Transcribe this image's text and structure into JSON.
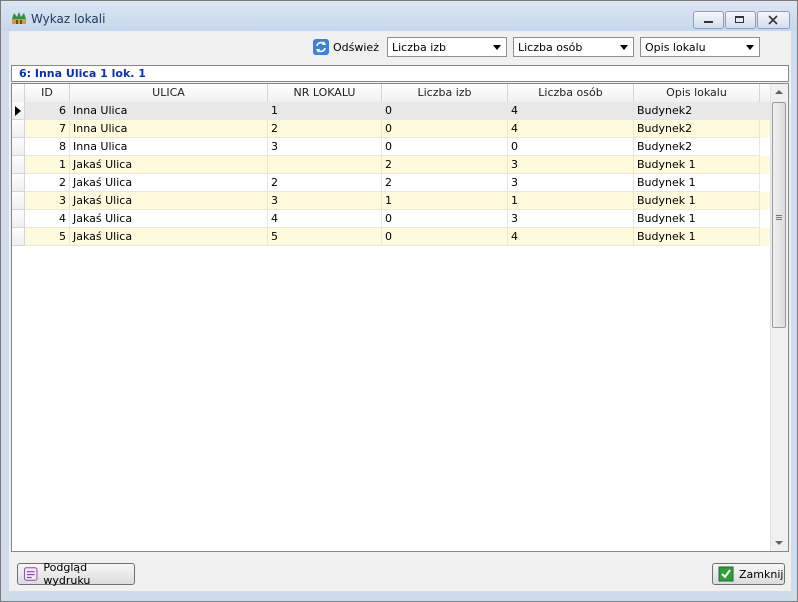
{
  "window": {
    "title": "Wykaz lokali",
    "icon": "crown-icon",
    "controls": [
      "minimize-icon",
      "maximize-icon",
      "close-icon"
    ]
  },
  "toolbar": {
    "refresh_label": "Odśwież",
    "refresh_icon": "refresh-icon",
    "filter_rooms": "Liczba izb",
    "filter_people": "Liczba osób",
    "filter_description": "Opis lokalu"
  },
  "record_label": "6: Inna Ulica 1 lok. 1",
  "grid": {
    "columns": [
      "ID",
      "ULICA",
      "NR LOKALU",
      "Liczba izb",
      "Liczba osób",
      "Opis lokalu"
    ],
    "rows": [
      {
        "id": "6",
        "ulica": "Inna Ulica",
        "nr": "1",
        "izb": "0",
        "osob": "4",
        "opis": "Budynek2",
        "current": true
      },
      {
        "id": "7",
        "ulica": "Inna Ulica",
        "nr": "2",
        "izb": "0",
        "osob": "4",
        "opis": "Budynek2"
      },
      {
        "id": "8",
        "ulica": "Inna Ulica",
        "nr": "3",
        "izb": "0",
        "osob": "0",
        "opis": "Budynek2"
      },
      {
        "id": "1",
        "ulica": "Jakaś Ulica",
        "nr": "",
        "izb": "2",
        "osob": "3",
        "opis": "Budynek 1"
      },
      {
        "id": "2",
        "ulica": "Jakaś Ulica",
        "nr": "2",
        "izb": "2",
        "osob": "3",
        "opis": "Budynek 1"
      },
      {
        "id": "3",
        "ulica": "Jakaś Ulica",
        "nr": "3",
        "izb": "1",
        "osob": "1",
        "opis": "Budynek 1"
      },
      {
        "id": "4",
        "ulica": "Jakaś Ulica",
        "nr": "4",
        "izb": "0",
        "osob": "3",
        "opis": "Budynek 1"
      },
      {
        "id": "5",
        "ulica": "Jakaś Ulica",
        "nr": "5",
        "izb": "0",
        "osob": "4",
        "opis": "Budynek 1"
      }
    ]
  },
  "footer": {
    "print_preview_label": "Podgląd wydruku",
    "close_label": "Zamknij"
  },
  "colors": {
    "record_label_text": "#0b2fb8",
    "alt_row": "#fffadc",
    "selected_row": "#e8e8e8"
  }
}
